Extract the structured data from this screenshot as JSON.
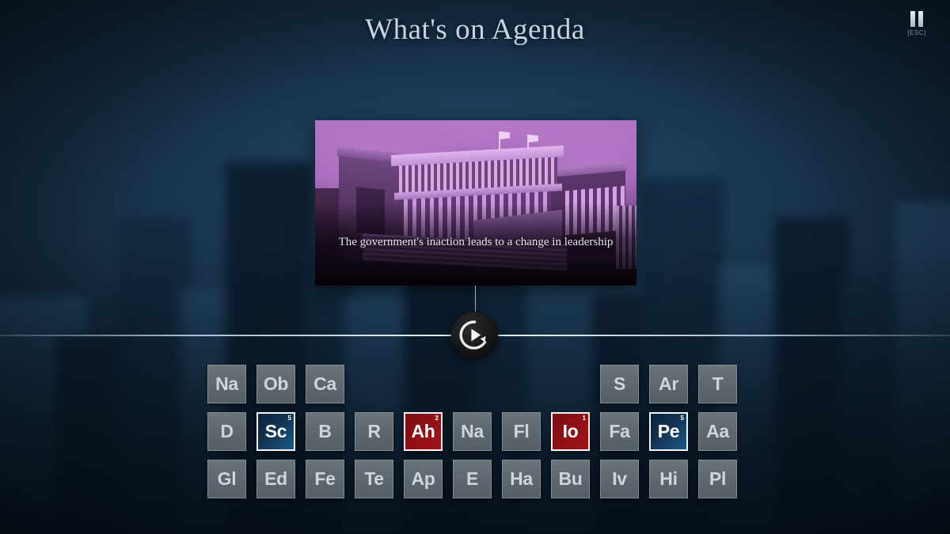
{
  "header": {
    "title": "What's on Agenda",
    "pause_icon": "pause-icon",
    "esc_label": "[ESC]"
  },
  "event_card": {
    "caption": "The government's inaction leads to a change in leadership",
    "art_description": "government-building",
    "art_tint": "#a063b5"
  },
  "timeline": {
    "play_icon": "play-resume-icon"
  },
  "colors": {
    "background": "#1d3d59",
    "tile_default": "#5e686e",
    "tile_selected_blue": "#123352",
    "tile_selected_red": "#8e1014",
    "tile_border_highlight": "#f2f6fa",
    "title_text": "#c3d4e2",
    "timeline_line": "#f4faff"
  },
  "tile_grid": {
    "rows": [
      {
        "row_index": 1,
        "tiles": [
          {
            "label": "Na",
            "state": "default",
            "sup": null
          },
          {
            "label": "Ob",
            "state": "default",
            "sup": null
          },
          {
            "label": "Ca",
            "state": "default",
            "sup": null
          },
          {
            "label": "",
            "state": "empty",
            "sup": null
          },
          {
            "label": "",
            "state": "empty",
            "sup": null
          },
          {
            "label": "",
            "state": "empty",
            "sup": null
          },
          {
            "label": "",
            "state": "empty",
            "sup": null
          },
          {
            "label": "",
            "state": "empty",
            "sup": null
          },
          {
            "label": "S",
            "state": "default",
            "sup": null
          },
          {
            "label": "Ar",
            "state": "default",
            "sup": null
          },
          {
            "label": "T",
            "state": "default",
            "sup": null
          }
        ]
      },
      {
        "row_index": 2,
        "tiles": [
          {
            "label": "D",
            "state": "default",
            "sup": null
          },
          {
            "label": "Sc",
            "state": "blue",
            "sup": "5"
          },
          {
            "label": "B",
            "state": "default",
            "sup": null
          },
          {
            "label": "R",
            "state": "default",
            "sup": null
          },
          {
            "label": "Ah",
            "state": "red",
            "sup": "2"
          },
          {
            "label": "Na",
            "state": "default",
            "sup": null
          },
          {
            "label": "Fl",
            "state": "default",
            "sup": null
          },
          {
            "label": "Io",
            "state": "red",
            "sup": "1"
          },
          {
            "label": "Fa",
            "state": "default",
            "sup": null
          },
          {
            "label": "Pe",
            "state": "blue",
            "sup": "5"
          },
          {
            "label": "Aa",
            "state": "default",
            "sup": null
          }
        ]
      },
      {
        "row_index": 3,
        "tiles": [
          {
            "label": "Gl",
            "state": "default",
            "sup": null
          },
          {
            "label": "Ed",
            "state": "default",
            "sup": null
          },
          {
            "label": "Fe",
            "state": "default",
            "sup": null
          },
          {
            "label": "Te",
            "state": "default",
            "sup": null
          },
          {
            "label": "Ap",
            "state": "default",
            "sup": null
          },
          {
            "label": "E",
            "state": "default",
            "sup": null
          },
          {
            "label": "Ha",
            "state": "default",
            "sup": null
          },
          {
            "label": "Bu",
            "state": "default",
            "sup": null
          },
          {
            "label": "Iv",
            "state": "default",
            "sup": null
          },
          {
            "label": "Hi",
            "state": "default",
            "sup": null
          },
          {
            "label": "Pl",
            "state": "default",
            "sup": null
          }
        ]
      }
    ]
  }
}
